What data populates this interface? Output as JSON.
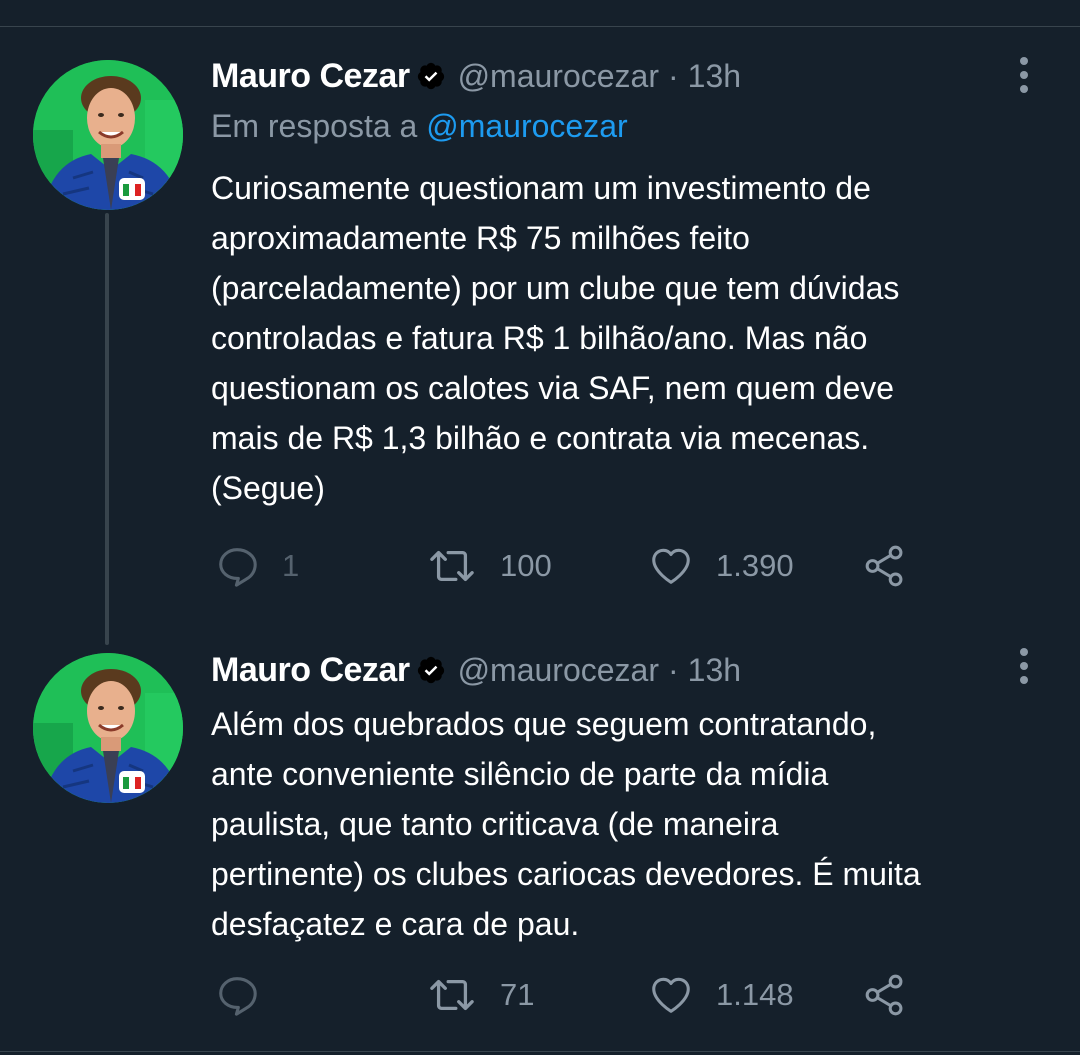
{
  "tweets": [
    {
      "author_name": "Mauro Cezar",
      "handle": "@maurocezar",
      "separator": "·",
      "timestamp": "13h",
      "reply_prefix": "Em resposta a",
      "reply_mention": "@maurocezar",
      "text_lines": [
        "Curiosamente questionam um investimento de",
        "aproximadamente R$ 75 milhões feito",
        "(parceladamente) por um clube que tem dúvidas",
        "controladas e fatura R$ 1 bilhão/ano. Mas não",
        "questionam os calotes via SAF, nem quem deve",
        "mais de R$ 1,3 bilhão e contrata via mecenas.",
        "(Segue)"
      ],
      "replies": "1",
      "retweets": "100",
      "likes": "1.390",
      "icons": [
        "verified-badge-icon",
        "more-options-icon",
        "reply-icon",
        "retweet-icon",
        "like-icon",
        "share-icon"
      ]
    },
    {
      "author_name": "Mauro Cezar",
      "handle": "@maurocezar",
      "separator": "·",
      "timestamp": "13h",
      "text_lines": [
        "Além dos quebrados que seguem contratando,",
        "ante conveniente silêncio de parte da mídia",
        "paulista, que tanto criticava (de maneira",
        "pertinente) os clubes cariocas devedores. É muita",
        "desfaçatez e cara de pau."
      ],
      "retweets": "71",
      "likes": "1.148",
      "icons": [
        "verified-badge-icon",
        "more-options-icon",
        "reply-icon",
        "retweet-icon",
        "like-icon",
        "share-icon"
      ]
    }
  ],
  "colors": {
    "background": "#15202b",
    "text_primary": "#ffffff",
    "text_secondary": "#8b98a5",
    "link": "#1d9bf0",
    "divider": "#38444d"
  }
}
